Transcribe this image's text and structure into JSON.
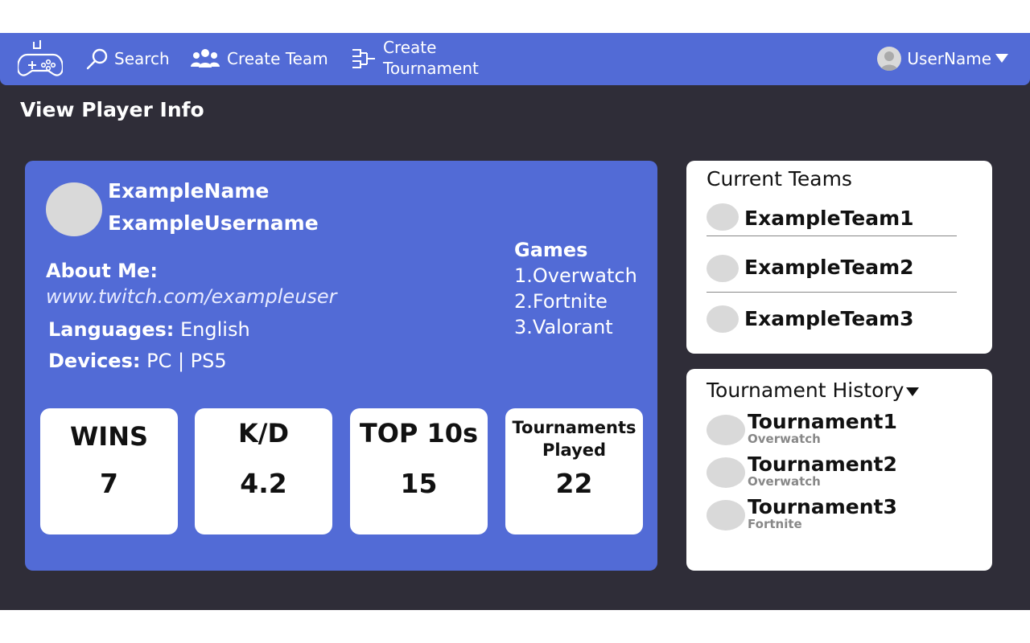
{
  "nav": {
    "logo_icon": "gamepad-icon",
    "search_label": "Search",
    "create_team_label": "Create Team",
    "create_tournament_line1": "Create",
    "create_tournament_line2": "Tournament",
    "username": "UserName",
    "accent": "#526bd6"
  },
  "page": {
    "title": "View Player Info"
  },
  "profile": {
    "name": "ExampleName",
    "username": "ExampleUsername",
    "about_label": "About Me:",
    "about_link": "www.twitch.com/exampleuser",
    "languages_label": "Languages:",
    "languages_value": " English",
    "devices_label": "Devices:",
    "devices_value": " PC | PS5",
    "games_title": "Games",
    "games": [
      "1.Overwatch",
      "2.Fortnite",
      "3.Valorant"
    ]
  },
  "stats": [
    {
      "label": "WINS",
      "value": "7"
    },
    {
      "label": "K/D",
      "value": "4.2"
    },
    {
      "label": "TOP 10s",
      "value": "15"
    },
    {
      "label_line1": "Tournaments",
      "label_line2": "Played",
      "value": "22"
    }
  ],
  "teams": {
    "title": "Current Teams",
    "items": [
      "ExampleTeam1",
      "ExampleTeam2",
      "ExampleTeam3"
    ]
  },
  "history": {
    "title": "Tournament History",
    "items": [
      {
        "name": "Tournament1",
        "game": "Overwatch"
      },
      {
        "name": "Tournament2",
        "game": "Overwatch"
      },
      {
        "name": "Tournament3",
        "game": "Fortnite"
      }
    ]
  }
}
